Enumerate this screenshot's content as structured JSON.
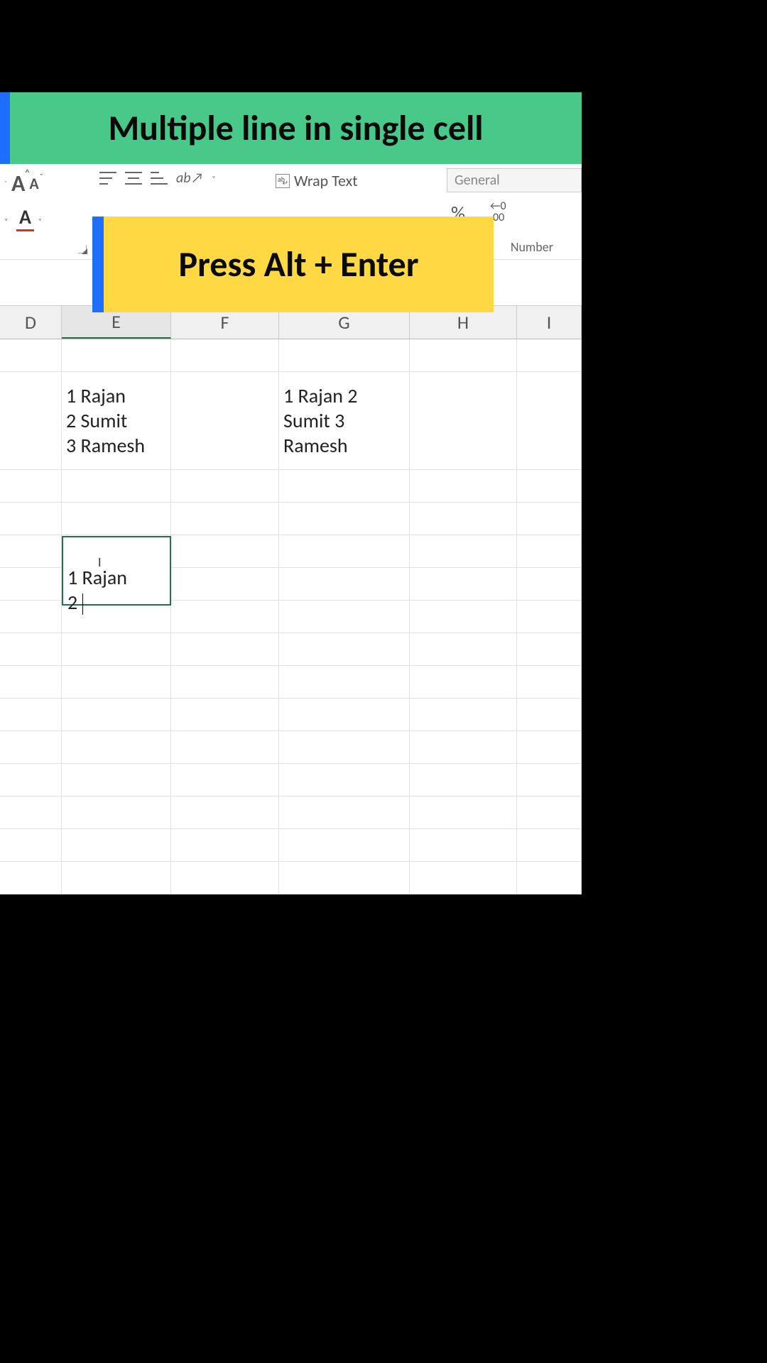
{
  "title": "Multiple line in single cell",
  "tip": "Press Alt + Enter",
  "ribbon": {
    "wrap_text_label": "Wrap Text",
    "number_format": "General",
    "number_group_label": "Number",
    "percent_btn": "%",
    "comma_btn": ",",
    "decimal_btn": "←0\n.00"
  },
  "columns": [
    "D",
    "E",
    "F",
    "G",
    "H",
    "I"
  ],
  "selected_column": "E",
  "cells": {
    "E2": "1 Rajan\n2 Sumit\n3 Ramesh",
    "G2": "1 Rajan 2\nSumit 3\nRamesh",
    "E6_editing": "1 Rajan\n2 "
  }
}
